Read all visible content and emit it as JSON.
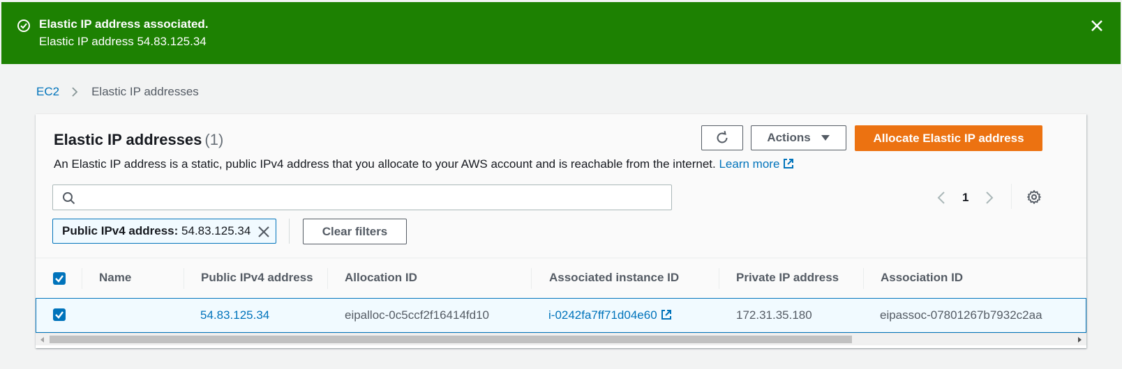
{
  "flash": {
    "title": "Elastic IP address associated.",
    "message": "Elastic IP address 54.83.125.34",
    "icon": "success-check-icon",
    "color": "#1d8102"
  },
  "breadcrumb": {
    "root": "EC2",
    "current": "Elastic IP addresses"
  },
  "header": {
    "title": "Elastic IP addresses",
    "count": "(1)",
    "description": "An Elastic IP address is a static, public IPv4 address that you allocate to your AWS account and is reachable from the internet.",
    "learn_more": "Learn more",
    "actions_label": "Actions",
    "allocate_label": "Allocate Elastic IP address",
    "accent_color": "#ec7211"
  },
  "search": {
    "placeholder": "",
    "value": ""
  },
  "pagination": {
    "current_page": "1"
  },
  "filter": {
    "key": "Public IPv4 address:",
    "value": "54.83.125.34",
    "clear_label": "Clear filters"
  },
  "table": {
    "columns": [
      "Name",
      "Public IPv4 address",
      "Allocation ID",
      "Associated instance ID",
      "Private IP address",
      "Association ID"
    ],
    "rows": [
      {
        "selected": true,
        "name": "",
        "public_ip": "54.83.125.34",
        "allocation_id": "eipalloc-0c5ccf2f16414fd10",
        "instance_id": "i-0242fa7ff71d04e60",
        "private_ip": "172.31.35.180",
        "association_id": "eipassoc-07801267b7932c2aa"
      }
    ]
  }
}
